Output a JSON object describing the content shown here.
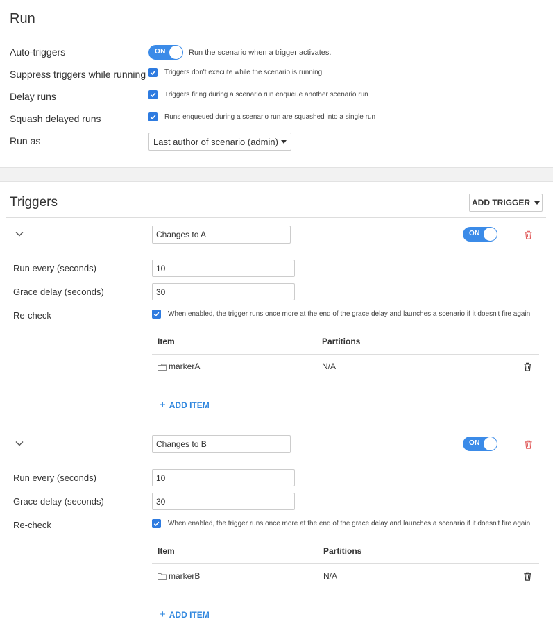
{
  "run": {
    "title": "Run",
    "auto_triggers": {
      "label": "Auto-triggers",
      "toggle_state": "ON",
      "description": "Run the scenario when a trigger activates."
    },
    "suppress": {
      "label": "Suppress triggers while running",
      "checked": true,
      "description": "Triggers don't execute while the scenario is running"
    },
    "delay": {
      "label": "Delay runs",
      "checked": true,
      "description": "Triggers firing during a scenario run enqueue another scenario run"
    },
    "squash": {
      "label": "Squash delayed runs",
      "checked": true,
      "description": "Runs enqueued during a scenario run are squashed into a single run"
    },
    "run_as": {
      "label": "Run as",
      "value": "Last author of scenario (admin)"
    }
  },
  "triggers_section": {
    "title": "Triggers",
    "add_trigger_label": "ADD TRIGGER"
  },
  "triggers": [
    {
      "name": "Changes to A",
      "toggle_state": "ON",
      "run_every_label": "Run every (seconds)",
      "run_every_value": "10",
      "grace_label": "Grace delay (seconds)",
      "grace_value": "30",
      "recheck_label": "Re-check",
      "recheck_checked": true,
      "recheck_description": "When enabled, the trigger runs once more at the end of the grace delay and launches a scenario if it doesn't fire again",
      "table_headers": {
        "item": "Item",
        "partitions": "Partitions"
      },
      "items": [
        {
          "name": "markerA",
          "partitions": "N/A"
        }
      ],
      "add_item_label": "ADD ITEM"
    },
    {
      "name": "Changes to B",
      "toggle_state": "ON",
      "run_every_label": "Run every (seconds)",
      "run_every_value": "10",
      "grace_label": "Grace delay (seconds)",
      "grace_value": "30",
      "recheck_label": "Re-check",
      "recheck_checked": true,
      "recheck_description": "When enabled, the trigger runs once more at the end of the grace delay and launches a scenario if it doesn't fire again",
      "table_headers": {
        "item": "Item",
        "partitions": "Partitions"
      },
      "items": [
        {
          "name": "markerB",
          "partitions": "N/A"
        }
      ],
      "add_item_label": "ADD ITEM"
    }
  ],
  "colors": {
    "accent": "#3b8be8",
    "checkbox": "#2e7be0",
    "link": "#2e86de",
    "danger": "#e05a5a",
    "band": "#f2f2f2"
  },
  "icons": [
    "chevron-down-icon",
    "trash-icon",
    "folder-icon",
    "plus-icon",
    "caret-down-icon",
    "check-icon"
  ]
}
